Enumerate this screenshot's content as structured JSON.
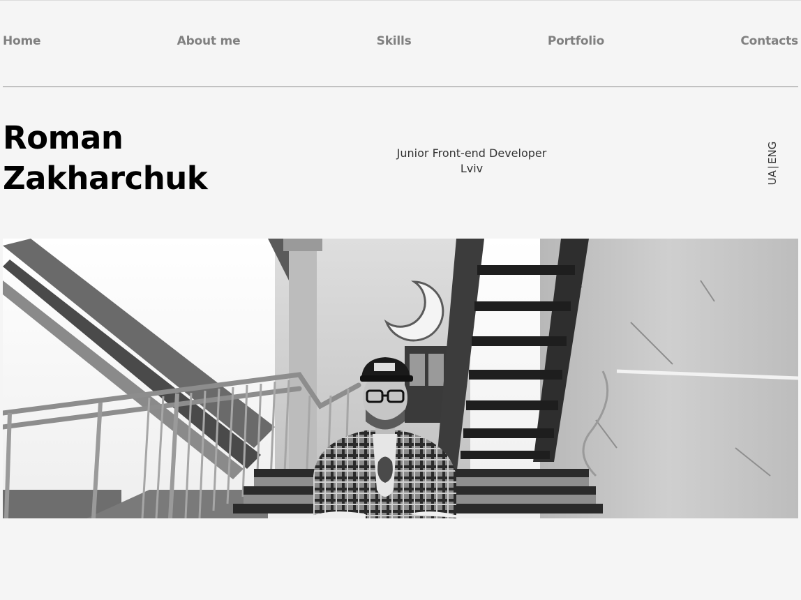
{
  "nav": {
    "items": [
      {
        "label": "Home"
      },
      {
        "label": "About me"
      },
      {
        "label": "Skills"
      },
      {
        "label": "Portfolio"
      },
      {
        "label": "Contacts"
      }
    ]
  },
  "header": {
    "first_name": "Roman",
    "last_name": "Zakharchuk",
    "role": "Junior Front-end Developer",
    "city": "Lviv"
  },
  "language": {
    "options": [
      "UA",
      "ENG"
    ],
    "separator": "|"
  },
  "hero": {
    "image_description": "black-and-white portrait photo of a man sitting on outdoor stairs"
  }
}
